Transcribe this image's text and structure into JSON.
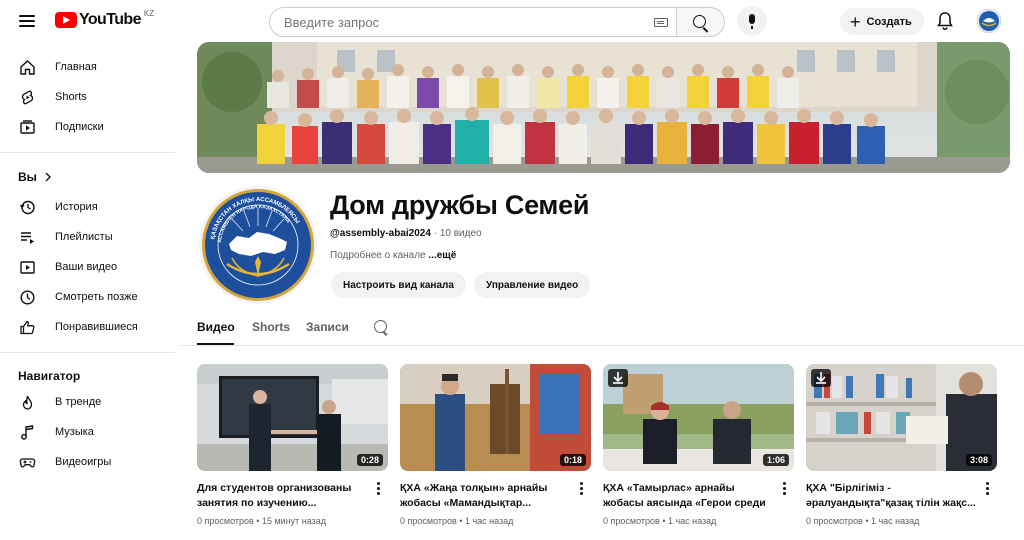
{
  "header": {
    "logo_text": "YouTube",
    "region": "KZ",
    "search_placeholder": "Введите запрос",
    "create_label": "Создать"
  },
  "sidebar": {
    "main": [
      {
        "label": "Главная",
        "icon": "home-icon"
      },
      {
        "label": "Shorts",
        "icon": "shorts-icon"
      },
      {
        "label": "Подписки",
        "icon": "subscriptions-icon"
      }
    ],
    "you_heading": "Вы",
    "you": [
      {
        "label": "История",
        "icon": "history-icon"
      },
      {
        "label": "Плейлисты",
        "icon": "playlists-icon"
      },
      {
        "label": "Ваши видео",
        "icon": "your-videos-icon"
      },
      {
        "label": "Смотреть позже",
        "icon": "watch-later-icon"
      },
      {
        "label": "Понравившиеся",
        "icon": "liked-icon"
      }
    ],
    "nav_heading": "Навигатор",
    "nav": [
      {
        "label": "В тренде",
        "icon": "trending-icon"
      },
      {
        "label": "Музыка",
        "icon": "music-icon"
      },
      {
        "label": "Видеоигры",
        "icon": "gaming-icon"
      }
    ]
  },
  "channel": {
    "title": "Дом дружбы Семей",
    "handle": "@assembly-abai2024",
    "video_count": " · 10 видео",
    "about": "Подробнее о канале ",
    "about_more": "...ещё",
    "customize_label": "Настроить вид канала",
    "manage_label": "Управление видео",
    "logo_text_top": "ҚАЗАҚСТАН ХАЛҚЫ АССАМБЛЕЯСЫ",
    "logo_text_bottom": "АССАМБЛЕЯ НАРОДА КАЗАХСТАНА"
  },
  "tabs": [
    {
      "label": "Видео",
      "active": true
    },
    {
      "label": "Shorts",
      "active": false
    },
    {
      "label": "Записи",
      "active": false
    }
  ],
  "videos": [
    {
      "title": "Для студентов организованы занятия по изучению...",
      "duration": "0:28",
      "views": "0 просмотров",
      "age": "15 минут назад",
      "download_badge": false
    },
    {
      "title": "ҚХА «Жаңа толқын» арнайы жобасы «Мамандықтар...",
      "duration": "0:18",
      "views": "0 просмотров",
      "age": "1 час назад",
      "download_badge": false
    },
    {
      "title": "ҚХА «Тамырлас» арнайы жобасы аясында «Герои среди нас»...",
      "duration": "1:06",
      "views": "0 просмотров",
      "age": "1 час назад",
      "download_badge": true
    },
    {
      "title": "ҚХА \"Бірлігіміз - әралуандықта\"қазақ тілін жақс...",
      "duration": "3:08",
      "views": "0 просмотров",
      "age": "1 час назад",
      "download_badge": true
    }
  ],
  "colors": {
    "brand_red": "#ff0000",
    "text_primary": "#0f0f0f",
    "text_secondary": "#606060",
    "chip_bg": "#f2f2f2"
  }
}
